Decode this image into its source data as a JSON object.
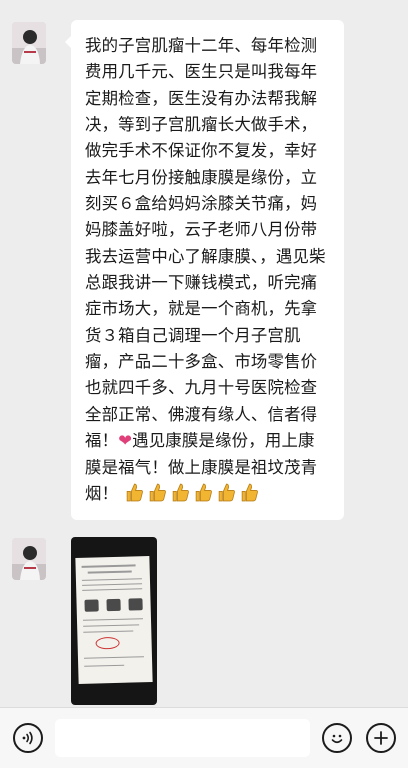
{
  "messages": [
    {
      "type": "text",
      "text": "我的子宫肌瘤十二年、每年检测费用几千元、医生只是叫我每年定期检查，医生没有办法帮我解决，等到子宫肌瘤长大做手术，做完手术不保证你不复发，幸好去年七月份接触康膜是缘份，立刻买６盒给妈妈涂膝关节痛，妈妈膝盖好啦，云子老师八月份带我去运营中心了解康膜、，遇见柴总跟我讲一下赚钱模式，听完痛症市场大，就是一个商机，先拿货３箱自己调理一个月子宫肌瘤，产品二十多盒、市场零售价也就四千多、九月十号医院检查全部正常、佛渡有缘人、信者得福！",
      "heart_emoji": "❤",
      "text_after_heart": "遇见康膜是缘份，用上康膜是福气！做上康膜是祖坟茂青烟！",
      "thumbs_icons": [
        "thumbs-up-icon",
        "thumbs-up-icon",
        "thumbs-up-icon",
        "thumbs-up-icon",
        "thumbs-up-icon",
        "thumbs-up-icon"
      ]
    },
    {
      "type": "image",
      "icon": "document-photo"
    }
  ],
  "input_bar": {
    "voice_icon": "voice-icon",
    "emoji_icon": "emoji-icon",
    "plus_icon": "plus-icon",
    "input_value": ""
  },
  "colors": {
    "background": "#ededed",
    "bubble": "#ffffff",
    "thumb": "#f2b531",
    "heart": "#e0407a"
  }
}
